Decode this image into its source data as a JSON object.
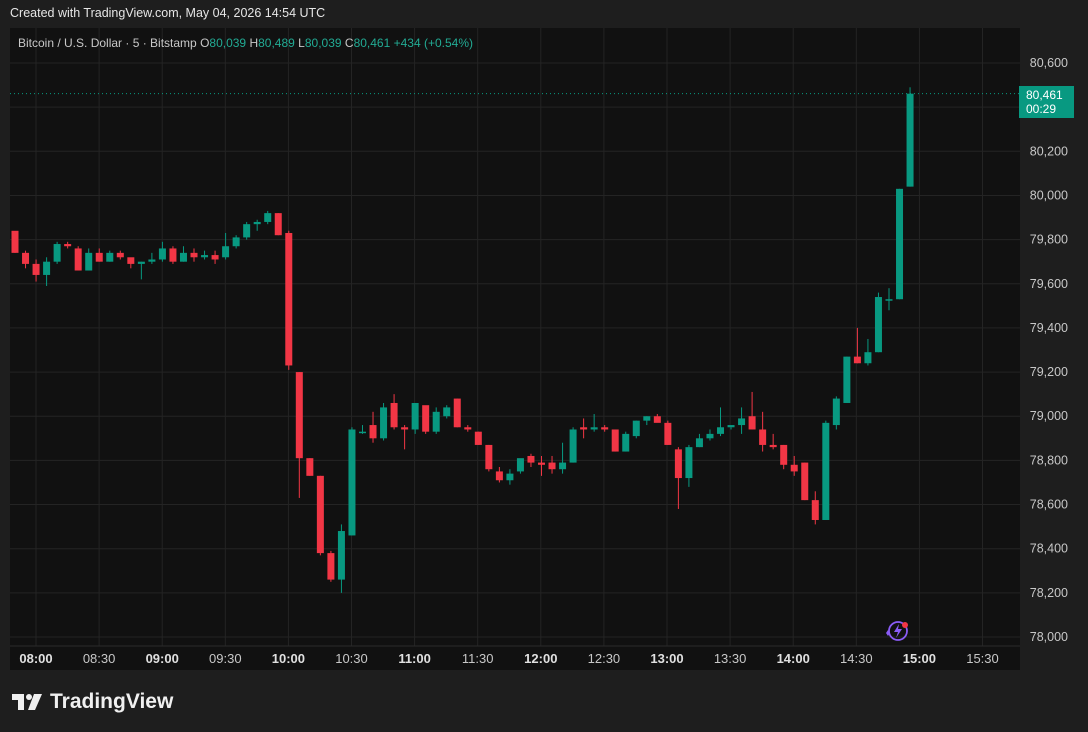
{
  "header": {
    "created_text": "Created with TradingView.com, May 04, 2026 14:54 UTC"
  },
  "legend": {
    "symbol": "Bitcoin / U.S. Dollar · 5 · Bitstamp",
    "o_label": "O",
    "o_value": "80,039",
    "h_label": "H",
    "h_value": "80,489",
    "l_label": "L",
    "l_value": "80,039",
    "c_label": "C",
    "c_value": "80,461",
    "change": "+434 (+0.54%)"
  },
  "price_badge": {
    "price": "80,461",
    "countdown": "00:29"
  },
  "brand": {
    "name": "TradingView"
  },
  "icons": {
    "logo": "tradingview-logo-icon",
    "flash": "flash-icon"
  },
  "colors": {
    "up": "#089981",
    "down": "#f23645",
    "background": "#111111",
    "grid": "#242424"
  },
  "chart_data": {
    "type": "candlestick",
    "y_axis": {
      "min": 78000,
      "max": 80600,
      "ticks": [
        "80,600",
        "80,200",
        "80,000",
        "79,800",
        "79,600",
        "79,400",
        "79,200",
        "79,000",
        "78,800",
        "78,600",
        "78,400",
        "78,200",
        "78,000"
      ],
      "tick_values": [
        80600,
        80200,
        80000,
        79800,
        79600,
        79400,
        79200,
        79000,
        78800,
        78600,
        78400,
        78200,
        78000
      ]
    },
    "x_axis": {
      "labels": [
        "08:00",
        "08:30",
        "09:00",
        "09:30",
        "10:00",
        "10:30",
        "11:00",
        "11:30",
        "12:00",
        "12:30",
        "13:00",
        "13:30",
        "14:00",
        "14:30",
        "15:00",
        "15:30"
      ],
      "bold": [
        true,
        false,
        true,
        false,
        true,
        false,
        true,
        false,
        true,
        false,
        true,
        false,
        true,
        false,
        true,
        false
      ]
    },
    "last_price": 80461,
    "candles": [
      [
        79840,
        79830,
        79740,
        79740
      ],
      [
        79740,
        79750,
        79670,
        79690
      ],
      [
        79690,
        79710,
        79610,
        79640
      ],
      [
        79640,
        79720,
        79590,
        79700
      ],
      [
        79700,
        79790,
        79690,
        79780
      ],
      [
        79780,
        79790,
        79760,
        79770
      ],
      [
        79760,
        79770,
        79660,
        79660
      ],
      [
        79660,
        79760,
        79660,
        79740
      ],
      [
        79740,
        79760,
        79700,
        79700
      ],
      [
        79700,
        79750,
        79700,
        79740
      ],
      [
        79740,
        79750,
        79710,
        79720
      ],
      [
        79720,
        79710,
        79670,
        79690
      ],
      [
        79690,
        79700,
        79620,
        79700
      ],
      [
        79700,
        79740,
        79690,
        79710
      ],
      [
        79710,
        79790,
        79700,
        79760
      ],
      [
        79760,
        79770,
        79690,
        79700
      ],
      [
        79700,
        79770,
        79700,
        79740
      ],
      [
        79740,
        79760,
        79700,
        79720
      ],
      [
        79720,
        79750,
        79710,
        79730
      ],
      [
        79730,
        79750,
        79690,
        79710
      ],
      [
        79720,
        79830,
        79710,
        79770
      ],
      [
        79770,
        79820,
        79760,
        79810
      ],
      [
        79810,
        79880,
        79800,
        79870
      ],
      [
        79870,
        79890,
        79840,
        79880
      ],
      [
        79880,
        79930,
        79870,
        79920
      ],
      [
        79920,
        79920,
        79820,
        79820
      ],
      [
        79830,
        79840,
        79210,
        79230
      ],
      [
        79200,
        79200,
        78630,
        78810
      ],
      [
        78810,
        78810,
        78730,
        78730
      ],
      [
        78730,
        78730,
        78370,
        78380
      ],
      [
        78380,
        78390,
        78250,
        78260
      ],
      [
        78260,
        78510,
        78200,
        78480
      ],
      [
        78460,
        78950,
        78460,
        78940
      ],
      [
        78930,
        78960,
        78920,
        78930
      ],
      [
        78960,
        79020,
        78880,
        78900
      ],
      [
        78900,
        79060,
        78890,
        79040
      ],
      [
        79060,
        79100,
        78940,
        78950
      ],
      [
        78950,
        78960,
        78850,
        78940
      ],
      [
        78940,
        79060,
        78920,
        79060
      ],
      [
        79050,
        78980,
        78920,
        78930
      ],
      [
        78930,
        79040,
        78920,
        79020
      ],
      [
        79000,
        79050,
        78990,
        79040
      ],
      [
        79080,
        79080,
        78950,
        78950
      ],
      [
        78950,
        78960,
        78930,
        78940
      ],
      [
        78930,
        78930,
        78870,
        78870
      ],
      [
        78870,
        78870,
        78750,
        78760
      ],
      [
        78750,
        78770,
        78700,
        78710
      ],
      [
        78710,
        78760,
        78690,
        78740
      ],
      [
        78750,
        78800,
        78740,
        78810
      ],
      [
        78820,
        78830,
        78770,
        78790
      ],
      [
        78790,
        78820,
        78730,
        78780
      ],
      [
        78790,
        78820,
        78740,
        78760
      ],
      [
        78760,
        78880,
        78740,
        78790
      ],
      [
        78790,
        78950,
        78790,
        78940
      ],
      [
        78950,
        78990,
        78900,
        78940
      ],
      [
        78940,
        79010,
        78930,
        78950
      ],
      [
        78950,
        78960,
        78930,
        78940
      ],
      [
        78940,
        78940,
        78840,
        78840
      ],
      [
        78840,
        78930,
        78840,
        78920
      ],
      [
        78910,
        78980,
        78900,
        78980
      ],
      [
        78980,
        79000,
        78960,
        79000
      ],
      [
        79000,
        79010,
        78980,
        78970
      ],
      [
        78970,
        78980,
        78870,
        78870
      ],
      [
        78850,
        78860,
        78580,
        78720
      ],
      [
        78720,
        78870,
        78680,
        78860
      ],
      [
        78860,
        78920,
        78860,
        78900
      ],
      [
        78900,
        78940,
        78890,
        78920
      ],
      [
        78920,
        79040,
        78910,
        78950
      ],
      [
        78950,
        78950,
        78940,
        78960
      ],
      [
        78960,
        79040,
        78920,
        78990
      ],
      [
        79000,
        79110,
        78940,
        78940
      ],
      [
        78940,
        79020,
        78840,
        78870
      ],
      [
        78870,
        78920,
        78850,
        78860
      ],
      [
        78870,
        78870,
        78760,
        78780
      ],
      [
        78780,
        78820,
        78730,
        78750
      ],
      [
        78790,
        78790,
        78620,
        78620
      ],
      [
        78620,
        78660,
        78510,
        78530
      ],
      [
        78530,
        78980,
        78530,
        78970
      ],
      [
        78960,
        79090,
        78940,
        79080
      ],
      [
        79060,
        79270,
        79060,
        79270
      ],
      [
        79270,
        79400,
        79240,
        79240
      ],
      [
        79240,
        79350,
        79230,
        79290
      ],
      [
        79290,
        79560,
        79290,
        79540
      ],
      [
        79530,
        79580,
        79480,
        79530
      ],
      [
        79530,
        80030,
        79530,
        80030
      ],
      [
        80040,
        80490,
        80040,
        80461
      ]
    ]
  }
}
